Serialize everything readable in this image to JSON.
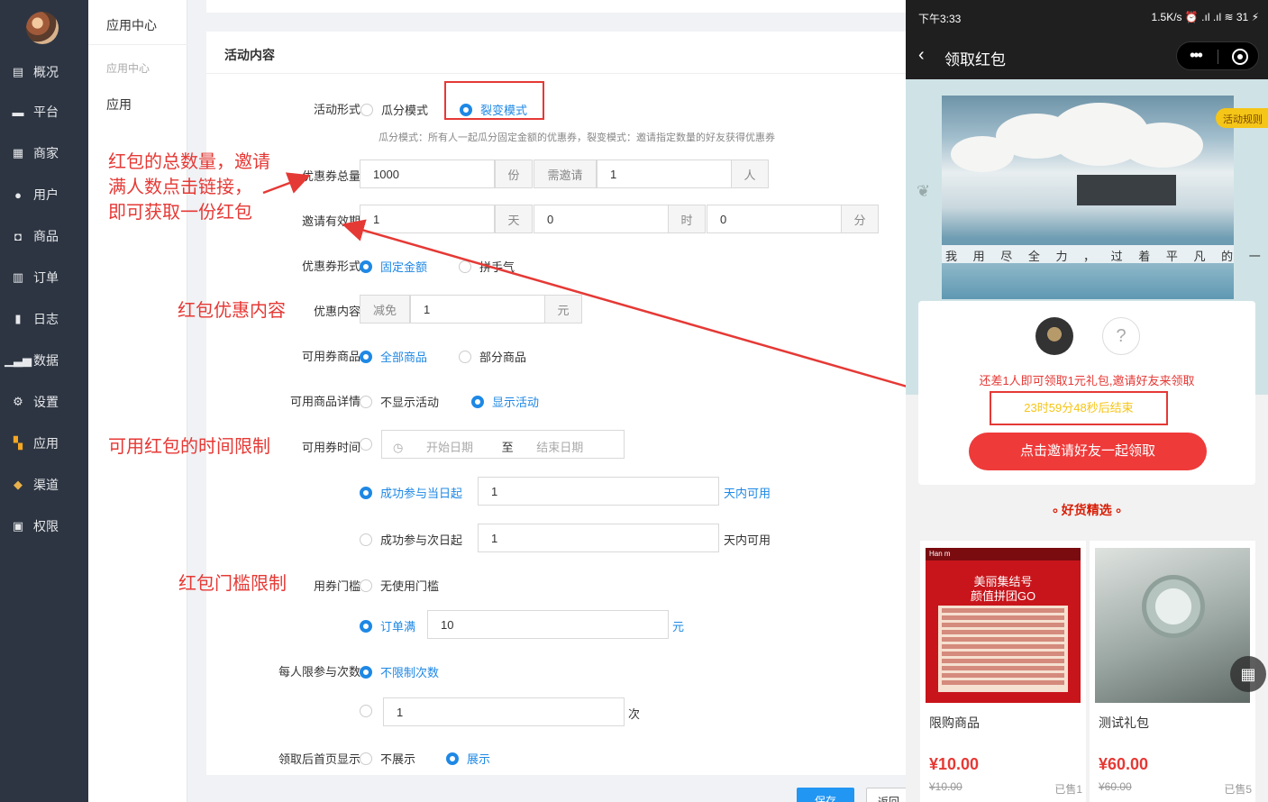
{
  "sidebar": {
    "items": [
      {
        "label": "概况",
        "icon": "chart-icon"
      },
      {
        "label": "平台",
        "icon": "monitor-icon"
      },
      {
        "label": "商家",
        "icon": "store-icon"
      },
      {
        "label": "用户",
        "icon": "user-icon"
      },
      {
        "label": "商品",
        "icon": "bag-icon"
      },
      {
        "label": "订单",
        "icon": "clipboard-icon"
      },
      {
        "label": "日志",
        "icon": "book-icon"
      },
      {
        "label": "数据",
        "icon": "bar-chart-icon"
      },
      {
        "label": "设置",
        "icon": "gear-icon"
      },
      {
        "label": "应用",
        "icon": "grid-icon"
      },
      {
        "label": "渠道",
        "icon": "cube-icon"
      },
      {
        "label": "权限",
        "icon": "lock-icon"
      }
    ]
  },
  "subsidebar": {
    "title": "应用中心",
    "group": "应用中心",
    "item": "应用"
  },
  "form": {
    "card_title": "活动内容",
    "activity_form": {
      "label": "活动形式",
      "opt1": "瓜分模式",
      "opt2": "裂变模式"
    },
    "hint": "瓜分模式：所有人一起瓜分固定金额的优惠券，裂变模式：邀请指定数量的好友获得优惠券",
    "coupon_total": {
      "label": "优惠券总量",
      "value": "1000",
      "unit": "份",
      "invite_prefix": "需邀请",
      "invite_value": "1",
      "invite_unit": "人"
    },
    "invite_period": {
      "label": "邀请有效期",
      "days": "1",
      "days_unit": "天",
      "hours": "0",
      "hours_unit": "时",
      "minutes": "0",
      "minutes_unit": "分"
    },
    "coupon_form": {
      "label": "优惠券形式",
      "opt1": "固定金额",
      "opt2": "拼手气"
    },
    "coupon_content": {
      "label": "优惠内容",
      "prefix": "减免",
      "value": "1",
      "unit": "元"
    },
    "goods": {
      "label": "可用券商品",
      "opt1": "全部商品",
      "opt2": "部分商品"
    },
    "goods_detail": {
      "label": "可用商品详情",
      "opt1": "不显示活动",
      "opt2": "显示活动"
    },
    "time": {
      "label": "可用券时间",
      "start_placeholder": "开始日期",
      "to": "至",
      "end_placeholder": "结束日期",
      "opt2": "成功参与当日起",
      "opt2_value": "1",
      "opt2_suffix": "天内可用",
      "opt3": "成功参与次日起",
      "opt3_value": "1",
      "opt3_suffix": "天内可用"
    },
    "threshold": {
      "label": "用券门槛",
      "opt1": "无使用门槛",
      "opt2": "订单满",
      "opt2_value": "10",
      "opt2_unit": "元"
    },
    "limit": {
      "label": "每人限参与次数",
      "opt1": "不限制次数",
      "value": "1",
      "unit": "次"
    },
    "home_show": {
      "label": "领取后首页显示",
      "opt1": "不展示",
      "opt2": "展示"
    },
    "save_label": "保存",
    "back_label": "返回"
  },
  "annotations": {
    "a1": "红包的总数量，邀请",
    "a1b": "满人数点击链接，",
    "a1c": "即可获取一份红包",
    "a2": "红包优惠内容",
    "a3": "可用红包的时间限制",
    "a4": "红包门槛限制"
  },
  "phone": {
    "status_time": "下午3:33",
    "status_right": "1.5K/s ⏰ .ıl .ıl ≋ 31 ⚡",
    "nav_title": "领取红包",
    "rule_tag": "活动规则",
    "photo_caption": "我 用 尽 全 力 ， 过 着 平 凡 的 一 生 。",
    "invite_tip": "还差1人即可领取1元礼包,邀请好友来领取",
    "countdown": "23时59分48秒后结束",
    "invite_button": "点击邀请好友一起领取",
    "goods_title": "好货精选",
    "goods": [
      {
        "name": "限购商品",
        "price": "¥10.00",
        "orig": "¥10.00",
        "sold": "已售1"
      },
      {
        "name": "测试礼包",
        "price": "¥60.00",
        "orig": "¥60.00",
        "sold": "已售5"
      }
    ],
    "poster_title": "美丽集结号",
    "poster_sub": "颜值拼团GO",
    "poster_brand": "Han m"
  },
  "colors": {
    "accent": "#1e88e5",
    "sidebar": "#2d3542",
    "annotation": "#e53935"
  }
}
